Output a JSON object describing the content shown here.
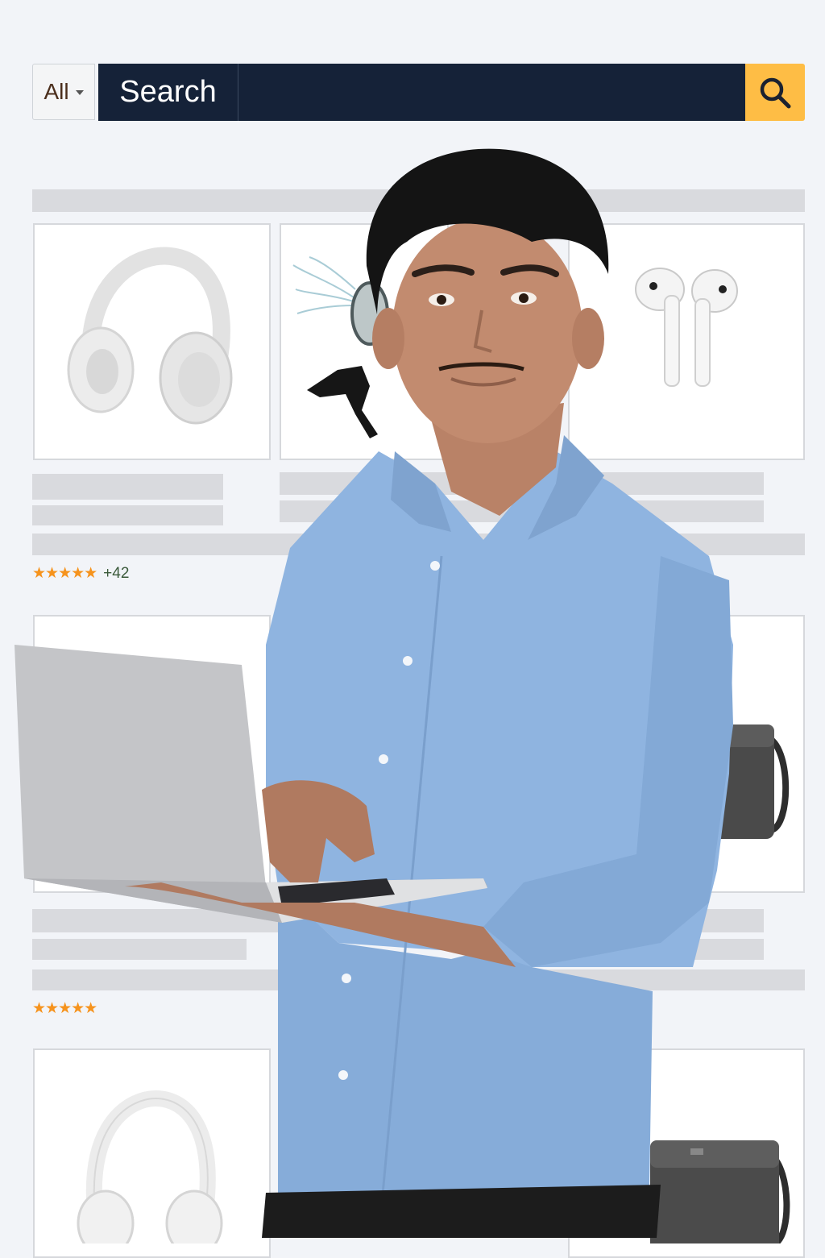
{
  "search": {
    "category_label": "All",
    "search_label": "Search"
  },
  "icons": {
    "search_button": "search-icon",
    "category_caret": "caret-down-icon",
    "rating": "star-icon"
  },
  "products": [
    {
      "id": "row1-col1",
      "image": "headphones",
      "rating_stars": "★★★★★",
      "review_count": "+42"
    },
    {
      "id": "row1-col2",
      "image": "desk-fan"
    },
    {
      "id": "row1-col3",
      "image": "wireless-earbuds"
    },
    {
      "id": "row2-col1",
      "image": "blank",
      "rating_stars": "★★★★★"
    },
    {
      "id": "row2-col3",
      "image": "messenger-bag"
    },
    {
      "id": "row3-col1",
      "image": "headphones"
    },
    {
      "id": "row3-col3",
      "image": "messenger-bag"
    }
  ],
  "colors": {
    "search_bar_bg": "#152238",
    "search_button_bg": "#febd45",
    "star": "#f6931d",
    "placeholder_bar": "#d9dade",
    "shirt": "#8fb4e0",
    "laptop": "#c4c5c8"
  }
}
